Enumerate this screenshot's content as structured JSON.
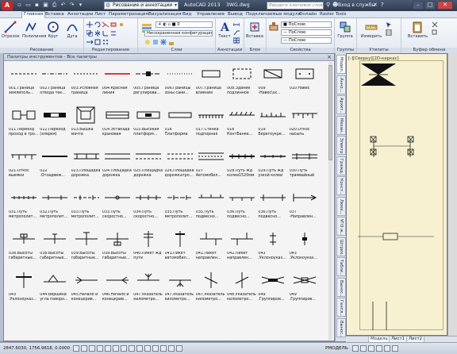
{
  "titlebar": {
    "logo": "A",
    "workspace": "Рисование и аннотации",
    "app": "AutoCAD 2013",
    "file": "3WG.dwg",
    "search_placeholder": "Введите ключевое слово/фразу",
    "signin": "Вход в службы"
  },
  "ribbon_tabs": [
    "Главная",
    "Вставка",
    "Аннотации",
    "Лист",
    "Параметризация",
    "Визуализация",
    "Вид",
    "Управление",
    "Вывод",
    "Подключаемые модули",
    "Онлайн",
    "Raster Tools"
  ],
  "ribbon": {
    "draw": {
      "title": "Рисование",
      "line": "Отрезок",
      "polyline": "Полилиния",
      "circle": "Круг",
      "arc": "Дуга"
    },
    "modify": {
      "title": "Редактирование"
    },
    "layers": {
      "title": "Слои",
      "layer_state": "Несохраненная конфигурация сло"
    },
    "annotation": {
      "title": "Аннотации",
      "text": "Текст"
    },
    "block": {
      "title": "Блок",
      "insert": "Вставка"
    },
    "properties": {
      "title": "Свойства",
      "color": "ПоСлою",
      "lineweight": "ПоСлою",
      "linetype": "ПоСлою"
    },
    "groups": {
      "title": "Группы",
      "label": "Группа"
    },
    "utilities": {
      "title": "Утилиты",
      "measure": "Измерить"
    },
    "clipboard": {
      "title": "Буфер обмена",
      "paste": "Вставить"
    }
  },
  "palette": {
    "title": "Палитры инструментов - Все палитры",
    "items": [
      {
        "label": "001.Граница\nземлеполь..."
      },
      {
        "label": "002.Граница\nотвода тек..."
      },
      {
        "label": "003.Условная\nграница"
      },
      {
        "label": "004.Красная\nлиния"
      },
      {
        "label": "005.Граница\nрегулирова..."
      },
      {
        "label": "006.Границы\nзоны сани..."
      },
      {
        "label": "007.Граница\nвлияния"
      },
      {
        "label": "008.Здание\nподлинное"
      },
      {
        "label": "009\n-Навес\\зх..."
      },
      {
        "label": "010.Навес"
      },
      {
        "label": "011.Переезд\nпроход в тро..."
      },
      {
        "label": "012.Переход\n(элерея)"
      },
      {
        "label": "013.Вышка\nмачта"
      },
      {
        "label": "014.Эстакада\nкрановая"
      },
      {
        "label": "015.Высокая\nплатформ..."
      },
      {
        "label": "016\nПлатформа"
      },
      {
        "label": "017.Стенка\nподпорная"
      },
      {
        "label": "018\nКонтБанке..."
      },
      {
        "label": "019\nБерегоукре..."
      },
      {
        "label": "020.Откос\nнасыпь"
      },
      {
        "label": "021.Откос\nвыемки"
      },
      {
        "label": "022\n.Отзадвиж..."
      },
      {
        "label": "023.Площадка\nдорожка трот..."
      },
      {
        "label": "024.Площадка\nдорожка трот..."
      },
      {
        "label": "025.Площадка\nдорожка трот..."
      },
      {
        "label": "026.Площадка\nдорожкатро..."
      },
      {
        "label": "027\nАвтомобил..."
      },
      {
        "label": "028.Путь жд\nколеи1520мм"
      },
      {
        "label": "029.Путь жд\nузкой колеи"
      },
      {
        "label": "030.Путь\nтрамвайный"
      },
      {
        "label": "031.Путь\nметрополит..."
      },
      {
        "label": "032.Путь\nметрополит..."
      },
      {
        "label": "033.Путь\nметрополит..."
      },
      {
        "label": "033.Путь\nскоростно..."
      },
      {
        "label": "034.Путь\nскоростно..."
      },
      {
        "label": "035.Путь\nметрополит..."
      },
      {
        "label": "035.Путь\nподвесно..."
      },
      {
        "label": "036.Путь\nподвесно..."
      },
      {
        "label": "036.Путь\nподвесно..."
      },
      {
        "label": "037\n-Направлен..."
      },
      {
        "label": "038.Высоты\nгабаритные..."
      },
      {
        "label": "038.Высоты\nгабаритные..."
      },
      {
        "label": "039.Высоты\nгабаритные..."
      },
      {
        "label": "039.Высоты\nгабаритные..."
      },
      {
        "label": "040.Пикет жд\nпути"
      },
      {
        "label": "041.Пикет\nавтомобил..."
      },
      {
        "label": "041.Пикет\nнаправлен..."
      },
      {
        "label": "042.Пикет\nнаправлен..."
      },
      {
        "label": "043\n.Уклоноуказ..."
      },
      {
        "label": "043\n.Уклоноуказ..."
      },
      {
        "label": "043\n.Уклоноуказ..."
      },
      {
        "label": "044.Вершина\nугла поворо..."
      },
      {
        "label": "045.Начало и\nконецкрив..."
      },
      {
        "label": "046.Начало и\nконецкрив..."
      },
      {
        "label": "047.Указатель\nкилометро..."
      },
      {
        "label": "047.Указатель\nкилометро..."
      },
      {
        "label": "047.Указатель\nкилометро..."
      },
      {
        "label": "048.Указатель\nкилометро..."
      },
      {
        "label": "049\n.Группиров..."
      },
      {
        "label": "049\n.Группиров..."
      }
    ]
  },
  "vtabs": [
    "Модел...",
    "Анно...",
    "Архит...",
    "Механ...",
    "Электр...",
    "Гражд...",
    "Конст...",
    "Люке...",
    "УГО ж...",
    "Штрих...",
    "Табли...",
    "Вынос...",
    "Генпл...",
    "Вынос..."
  ],
  "drawing": {
    "viewport_label": "[-][Сверху][2D-каркас]",
    "layout_tabs": [
      "Модель",
      "Лист1",
      "Лист2"
    ]
  },
  "status": {
    "coords": "2847.6030, 1756.9618, 0.0000",
    "mode": "РМОДЕЛЬ"
  }
}
